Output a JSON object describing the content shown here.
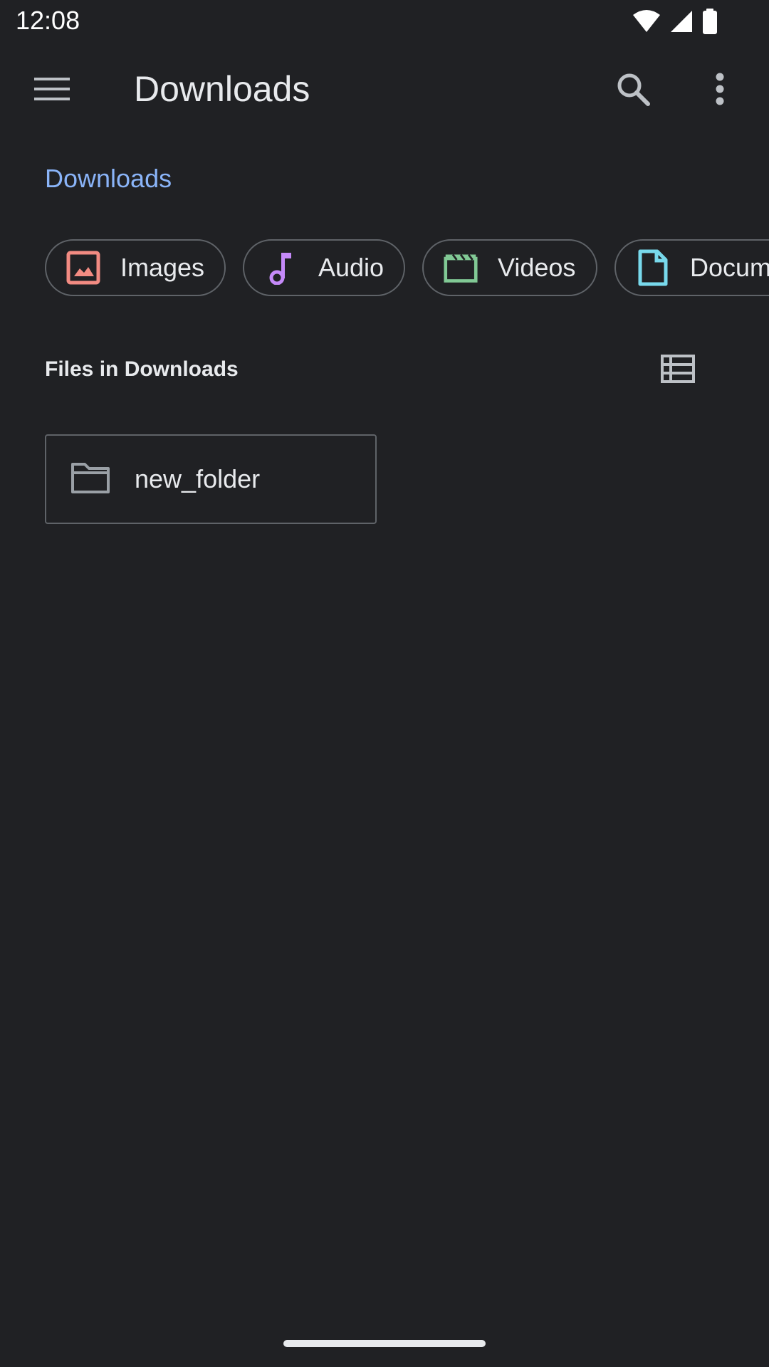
{
  "status_bar": {
    "time": "12:08",
    "icons": [
      "wifi-icon",
      "cell-signal-icon",
      "battery-icon"
    ]
  },
  "app_bar": {
    "title": "Downloads",
    "icons": [
      "menu-icon",
      "search-icon",
      "more-vert-icon"
    ]
  },
  "breadcrumb": {
    "label": "Downloads",
    "color": "#8ab4f8"
  },
  "chips": [
    {
      "label": "Images",
      "icon": "image-icon",
      "color": "#f28b82"
    },
    {
      "label": "Audio",
      "icon": "music-note-icon",
      "color": "#c58af9"
    },
    {
      "label": "Videos",
      "icon": "video-clip-icon",
      "color": "#81c995"
    },
    {
      "label": "Documents",
      "icon": "document-icon",
      "color": "#78d9ec"
    }
  ],
  "section": {
    "title": "Files in Downloads",
    "view_toggle_icon": "list-view-icon"
  },
  "items": [
    {
      "name": "new_folder",
      "icon": "folder-icon"
    }
  ],
  "colors": {
    "background": "#202124",
    "text": "#e8eaed",
    "outline": "#5f6368",
    "accent": "#8ab4f8"
  }
}
